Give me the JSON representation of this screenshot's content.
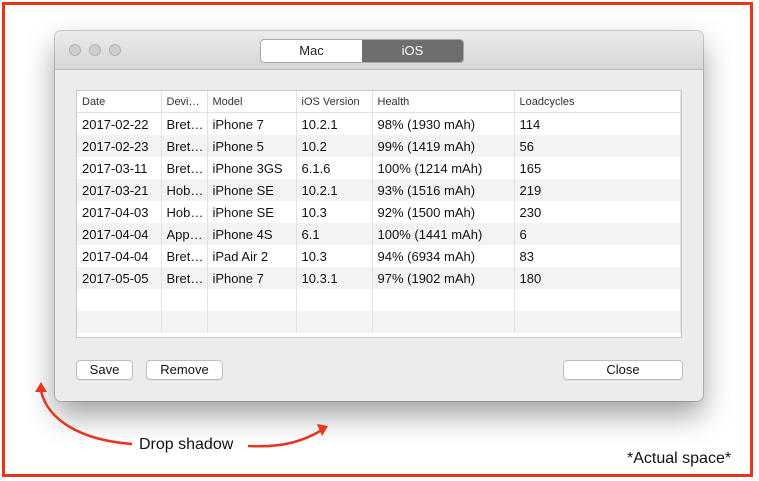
{
  "tabs": [
    {
      "label": "Mac",
      "selected": false
    },
    {
      "label": "iOS",
      "selected": true
    }
  ],
  "table": {
    "columns": [
      "Date",
      "Devi…",
      "Model",
      "iOS Version",
      "Health",
      "Loadcycles"
    ],
    "rows": [
      [
        "2017-02-22",
        "Bret…",
        "iPhone 7",
        "10.2.1",
        "98% (1930 mAh)",
        "114"
      ],
      [
        "2017-02-23",
        "Bret…",
        "iPhone 5",
        "10.2",
        "99% (1419 mAh)",
        "56"
      ],
      [
        "2017-03-11",
        "Bret…",
        "iPhone 3GS",
        "6.1.6",
        "100% (1214 mAh)",
        "165"
      ],
      [
        "2017-03-21",
        "Hob…",
        "iPhone SE",
        "10.2.1",
        "93% (1516 mAh)",
        "219"
      ],
      [
        "2017-04-03",
        "Hob…",
        "iPhone SE",
        "10.3",
        "92% (1500 mAh)",
        "230"
      ],
      [
        "2017-04-04",
        "App…",
        "iPhone 4S",
        "6.1",
        "100% (1441 mAh)",
        "6"
      ],
      [
        "2017-04-04",
        "Bret…",
        "iPad Air 2",
        "10.3",
        "94% (6934 mAh)",
        "83"
      ],
      [
        "2017-05-05",
        "Bret…",
        "iPhone 7",
        "10.3.1",
        "97% (1902 mAh)",
        "180"
      ]
    ]
  },
  "buttons": {
    "save": "Save",
    "remove": "Remove",
    "close": "Close"
  },
  "annotations": {
    "drop_shadow": "Drop shadow",
    "actual_space": "*Actual space*"
  },
  "colors": {
    "annotation_red": "#e8351c",
    "selected_tab": "#6e6e6e"
  }
}
